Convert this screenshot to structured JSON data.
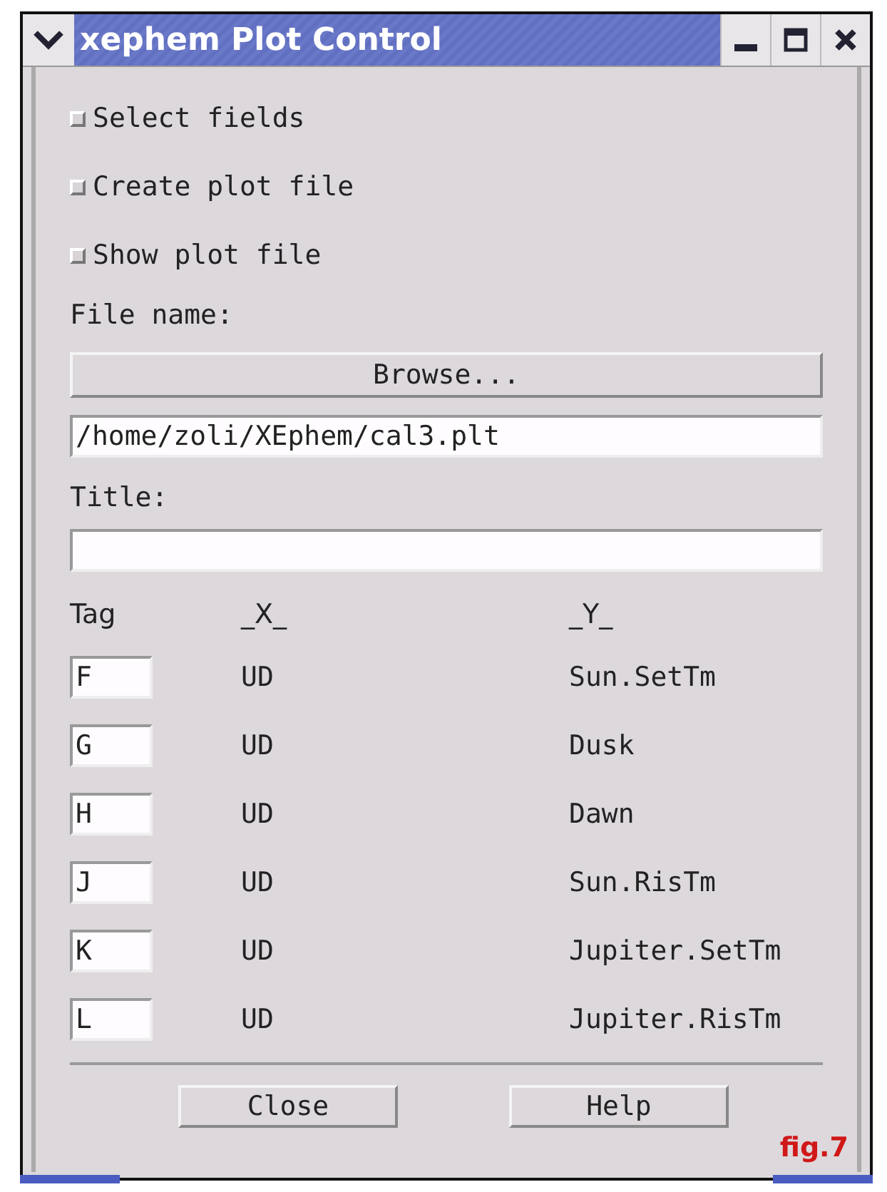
{
  "window": {
    "title": "xephem Plot Control"
  },
  "options": [
    {
      "label": "Select fields",
      "checked": false
    },
    {
      "label": "Create plot file",
      "checked": false
    },
    {
      "label": "Show plot file",
      "checked": false
    }
  ],
  "file_name_label": "File name:",
  "browse_button": "Browse...",
  "file_name": "/home/zoli/XEphem/cal3.plt",
  "title_label": "Title:",
  "table": {
    "columns": [
      "Tag",
      "_X_",
      "_Y_"
    ],
    "rows": [
      {
        "tag": "F",
        "x": "UD",
        "y": "Sun.SetTm"
      },
      {
        "tag": "G",
        "x": "UD",
        "y": "Dusk"
      },
      {
        "tag": "H",
        "x": "UD",
        "y": "Dawn"
      },
      {
        "tag": "J",
        "x": "UD",
        "y": "Sun.RisTm"
      },
      {
        "tag": "K",
        "x": "UD",
        "y": "Jupiter.SetTm"
      },
      {
        "tag": "L",
        "x": "UD",
        "y": "Jupiter.RisTm"
      }
    ]
  },
  "buttons": [
    "Close",
    "Help"
  ],
  "caption": "fig.7"
}
